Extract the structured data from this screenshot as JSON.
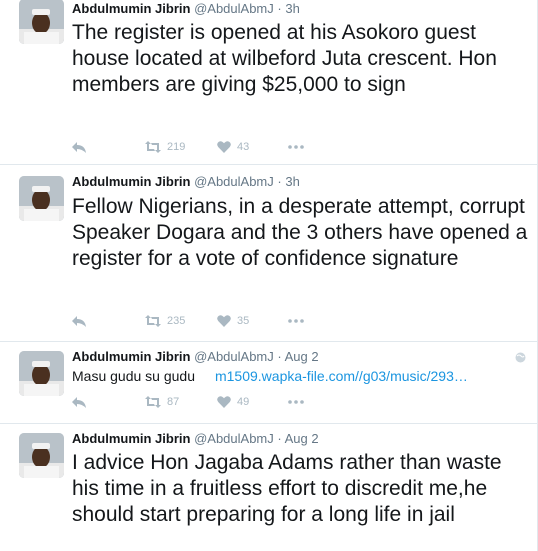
{
  "colors": {
    "text": "#14171a",
    "meta": "#657786",
    "action": "#aab8c2",
    "link": "#1b95e0",
    "divider": "#e1e8ed"
  },
  "tweets": [
    {
      "author": "Abdulmumin Jibrin",
      "handle": "@AbdulAbmJ",
      "separator": "·",
      "time": "3h",
      "text": "The register is opened at his Asokoro guest house located at wilbeford Juta crescent. Hon members are giving $25,000 to sign",
      "retweets": "219",
      "likes": "43"
    },
    {
      "author": "Abdulmumin Jibrin",
      "handle": "@AbdulAbmJ",
      "separator": "·",
      "time": "3h",
      "text": "Fellow Nigerians, in a desperate attempt, corrupt Speaker Dogara and the 3 others have opened a register for a vote of confidence signature",
      "retweets": "235",
      "likes": "35"
    },
    {
      "author": "Abdulmumin Jibrin",
      "handle": "@AbdulAbmJ",
      "separator": "·",
      "time": "Aug 2",
      "text": "Masu gudu su gudu",
      "link": "m1509.wapka-file.com//g03/music/293…",
      "retweets": "87",
      "likes": "49"
    },
    {
      "author": "Abdulmumin Jibrin",
      "handle": "@AbdulAbmJ",
      "separator": "·",
      "time": "Aug 2",
      "text": "I advice Hon Jagaba Adams rather than waste his time in a fruitless effort to discredit me,he should start preparing for a long life in jail"
    }
  ],
  "icons": {
    "reply": "reply-icon",
    "retweet": "retweet-icon",
    "like": "heart-icon",
    "more": "more-icon",
    "geo": "globe-icon"
  }
}
